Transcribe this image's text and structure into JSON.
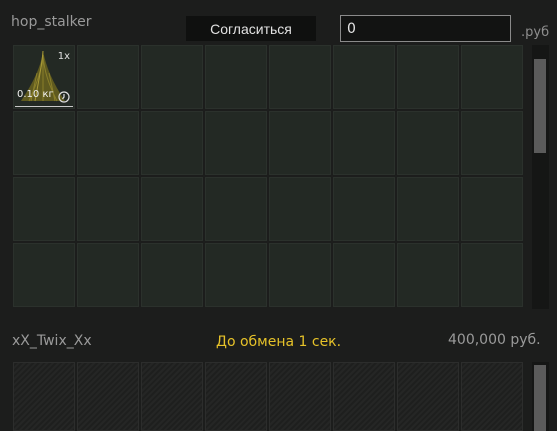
{
  "trader": {
    "name": "hop_stalker",
    "accept_label": "Согласиться",
    "money_value": "0",
    "currency": ".руб"
  },
  "item": {
    "quantity": "1x",
    "weight": "0.10 кг",
    "icon": "grass-item-icon"
  },
  "partner": {
    "name": "xX_Twix_Xx",
    "status": "До обмена 1 сек.",
    "money": "400,000 руб."
  },
  "colors": {
    "accent_status": "#e6c229",
    "cell_bg": "#232924",
    "page_bg": "#1c1d1c"
  }
}
